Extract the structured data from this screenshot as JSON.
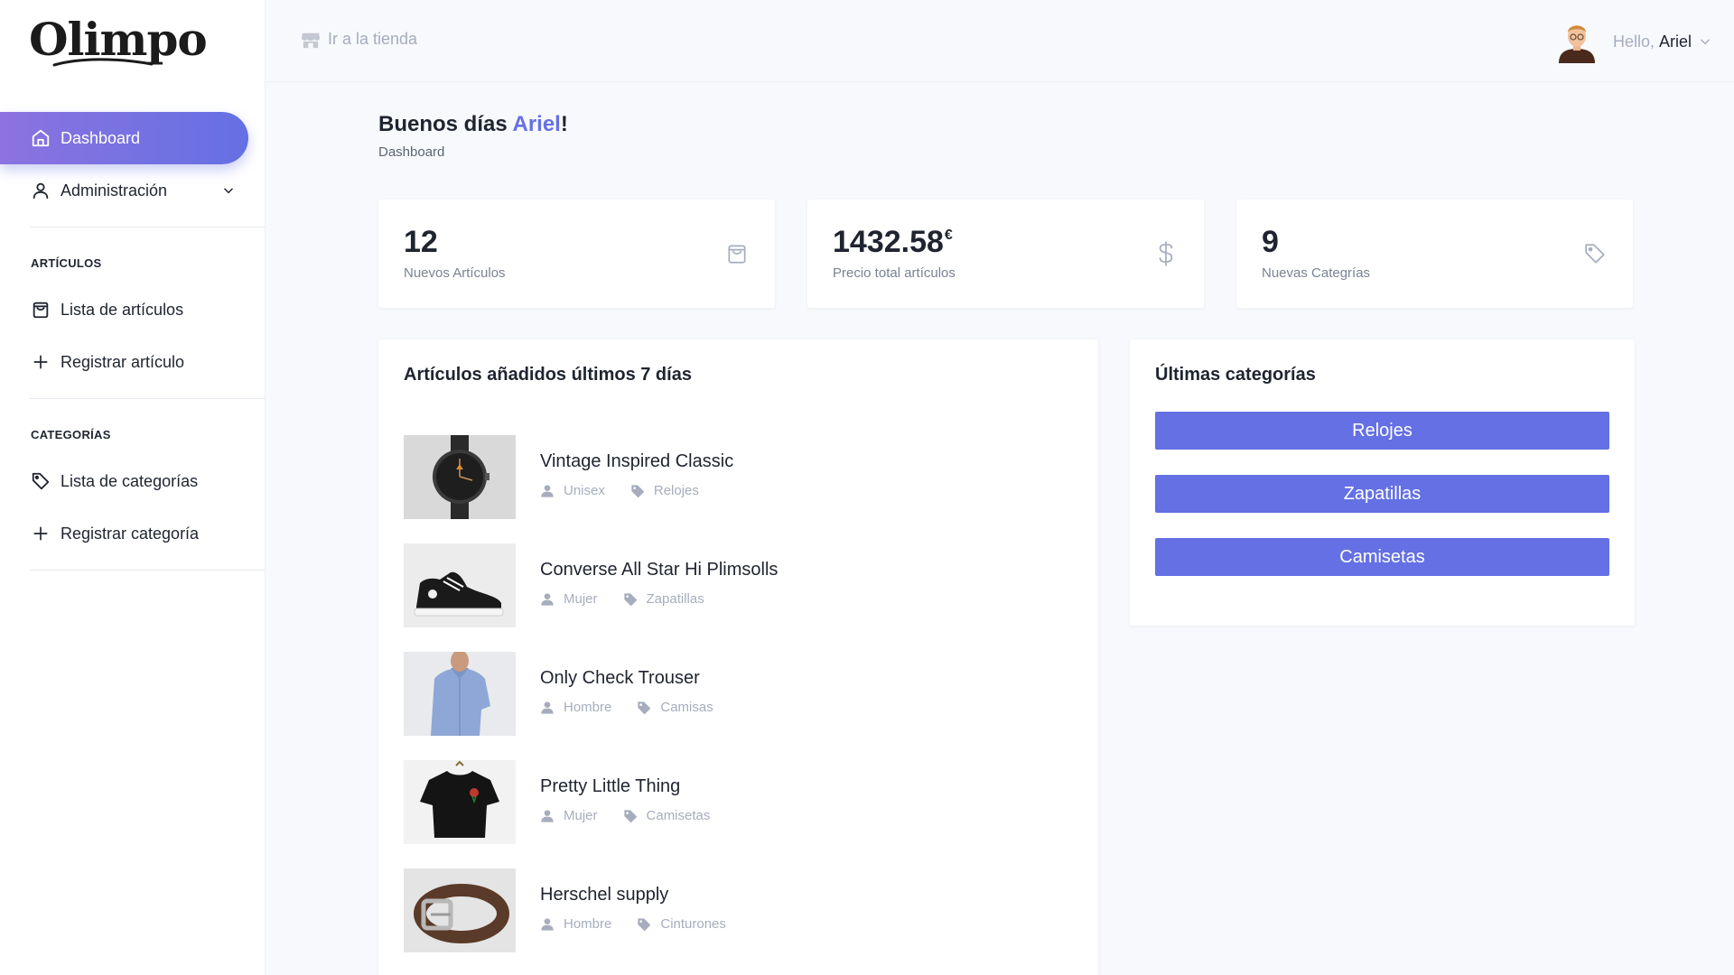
{
  "brand": {
    "logo": "Olimpo"
  },
  "sidebar": {
    "dashboard_label": "Dashboard",
    "admin_label": "Administración",
    "articles_section": "ARTÍCULOS",
    "articles_list_label": "Lista de artículos",
    "articles_register_label": "Registrar artículo",
    "categories_section": "CATEGORÍAS",
    "categories_list_label": "Lista de categorías",
    "categories_register_label": "Registrar categoría"
  },
  "topbar": {
    "store_link": "Ir a la tienda",
    "hello": "Hello,",
    "user_name": "Ariel"
  },
  "page": {
    "greeting": "Buenos días",
    "greeting_name": "Ariel",
    "greeting_suffix": "!",
    "breadcrumb": "Dashboard"
  },
  "stats": [
    {
      "value": "12",
      "unit": "",
      "label": "Nuevos Artículos",
      "icon": "shopping-bag-icon"
    },
    {
      "value": "1432.58",
      "unit": "€",
      "label": "Precio total artículos",
      "icon": "dollar-icon"
    },
    {
      "value": "9",
      "unit": "",
      "label": "Nuevas Categrías",
      "icon": "tag-icon"
    }
  ],
  "recent_articles": {
    "title": "Artículos añadidos últimos 7 días",
    "items": [
      {
        "name": "Vintage Inspired Classic",
        "gender": "Unisex",
        "category": "Relojes",
        "thumb": "watch"
      },
      {
        "name": "Converse All Star Hi Plimsolls",
        "gender": "Mujer",
        "category": "Zapatillas",
        "thumb": "sneaker"
      },
      {
        "name": "Only Check Trouser",
        "gender": "Hombre",
        "category": "Camisas",
        "thumb": "shirt"
      },
      {
        "name": "Pretty Little Thing",
        "gender": "Mujer",
        "category": "Camisetas",
        "thumb": "tshirt"
      },
      {
        "name": "Herschel supply",
        "gender": "Hombre",
        "category": "Cinturones",
        "thumb": "belt"
      }
    ]
  },
  "latest_categories": {
    "title": "Últimas categorías",
    "items": [
      "Relojes",
      "Zapatillas",
      "Camisetas"
    ]
  },
  "colors": {
    "accent": "#6470e3",
    "accent_gradient_start": "#8c73e0",
    "muted_text": "#a6adbd",
    "page_bg": "#f8f9fc"
  }
}
